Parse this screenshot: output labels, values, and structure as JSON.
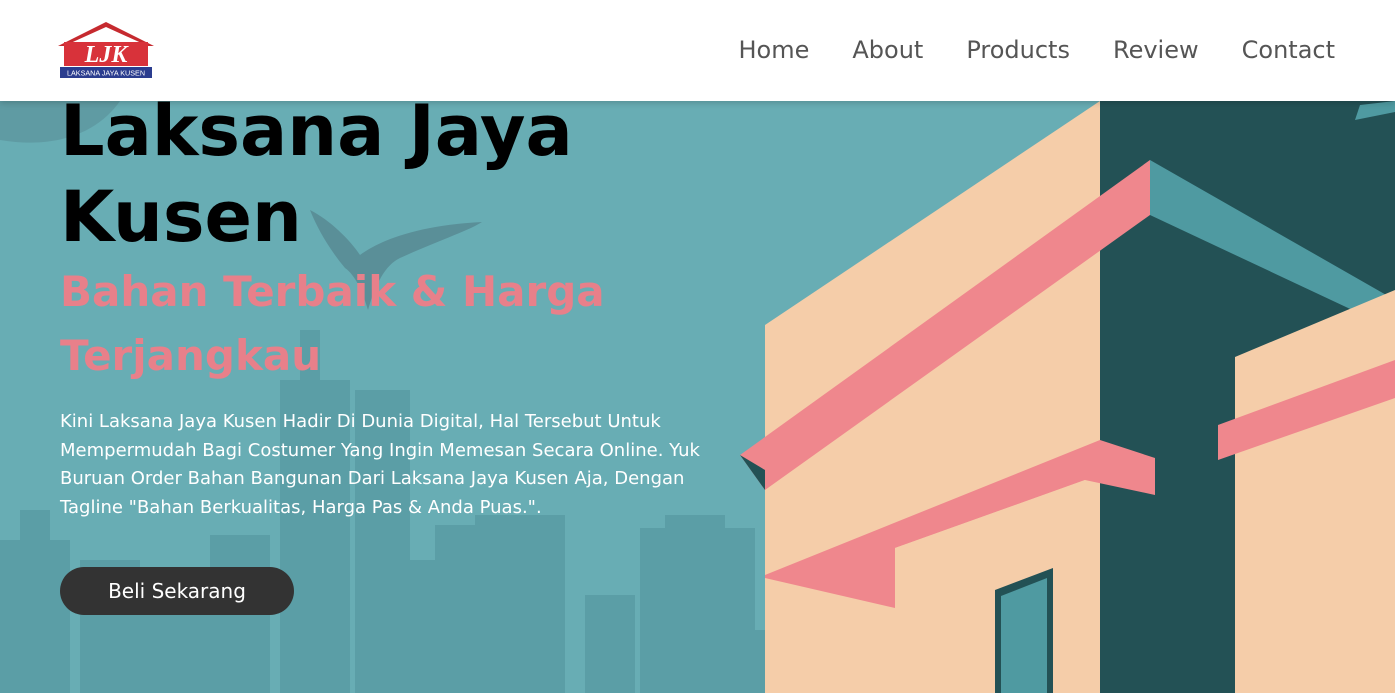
{
  "brand": {
    "logo_text": "LJK",
    "logo_subtext": "LAKSANA JAYA KUSEN"
  },
  "nav": {
    "items": [
      {
        "label": "Home"
      },
      {
        "label": "About"
      },
      {
        "label": "Products"
      },
      {
        "label": "Review"
      },
      {
        "label": "Contact"
      }
    ]
  },
  "hero": {
    "title": "Laksana Jaya Kusen",
    "subtitle": "Bahan Terbaik & Harga Terjangkau",
    "description": "Kini Laksana Jaya Kusen Hadir Di Dunia Digital, Hal Tersebut Untuk Mempermudah Bagi Costumer Yang Ingin Memesan Secara Online. Yuk Buruan Order Bahan Bangunan Dari Laksana Jaya Kusen Aja, Dengan Tagline \"Bahan Berkualitas, Harga Pas & Anda Puas.\".",
    "cta_label": "Beli Sekarang"
  },
  "colors": {
    "background": "#68adb4",
    "building_peach": "#f5cda9",
    "building_dark": "#235155",
    "accent_pink": "#ef878d",
    "subtitle": "#e8808a",
    "button": "#333333",
    "nav_text": "#555555"
  }
}
